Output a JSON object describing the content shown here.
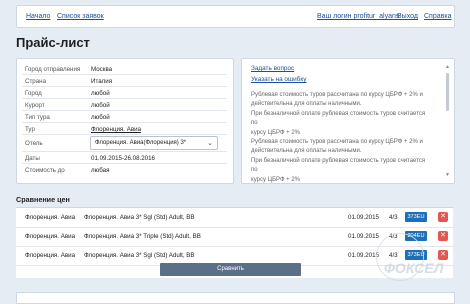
{
  "nav": {
    "home": "Начало",
    "requests": "Список заявок",
    "login_text": "Ваш логин profitur_alyans",
    "logout": "Выход",
    "help": "Справка"
  },
  "page_title": "Прайс-лист",
  "info": {
    "rows": [
      {
        "label": "Город отправления",
        "value": "Москва"
      },
      {
        "label": "Страна",
        "value": "Италия"
      },
      {
        "label": "Город",
        "value": "любой"
      },
      {
        "label": "Курорт",
        "value": "любой"
      },
      {
        "label": "Тип тура",
        "value": "любой"
      },
      {
        "label": "Тур",
        "value": "Флоренция. Авиа"
      },
      {
        "label": "Отель",
        "value": "Флоренция. Авиа(Флоренция) 3*"
      },
      {
        "label": "Даты",
        "value": "01.09.2015-26.08.2016"
      },
      {
        "label": "Стоимость до",
        "value": "любая"
      }
    ]
  },
  "notes": {
    "ask": "Задать вопрос",
    "report": "Указать на ошибку",
    "lines": [
      "Рублевая стоимость туров рассчитана по курсу ЦБРФ + 2% и",
      "действительна для оплаты наличными.",
      "При безналичной оплате рублевая стоимость туров считается по",
      "курсу ЦБРФ + 2%",
      "Рублевая стоимость туров рассчитана по курсу ЦБРФ + 2% и",
      "действительна для оплаты наличными.",
      "При безналичной оплате рублевая стоимость туров считается по",
      "курсу ЦБРФ + 2%"
    ]
  },
  "compare": {
    "title": "Сравнение цен",
    "rows": [
      {
        "tour": "Флоренция. Авиа",
        "desc": "Флоренция. Авиа 3* Sgl (Std) Adult, BB",
        "date": "01.09.2015",
        "nights": "4/3",
        "price": "373EU"
      },
      {
        "tour": "Флоренция. Авиа",
        "desc": "Флоренция. Авиа 3* Triple (Std) Adult, BB",
        "date": "01.09.2015",
        "nights": "4/3",
        "price": "204EU"
      },
      {
        "tour": "Флоренция. Авиа",
        "desc": "Флоренция. Авиа 3* Sgl (Std) Adult, BB",
        "date": "01.09.2015",
        "nights": "4/3",
        "price": "373EU"
      }
    ],
    "button": "Сравнить"
  },
  "watermark": "ФОКСЕЛ",
  "colors": {
    "accent": "#1e6fb8",
    "delete": "#e2574f",
    "button": "#5b7088"
  }
}
